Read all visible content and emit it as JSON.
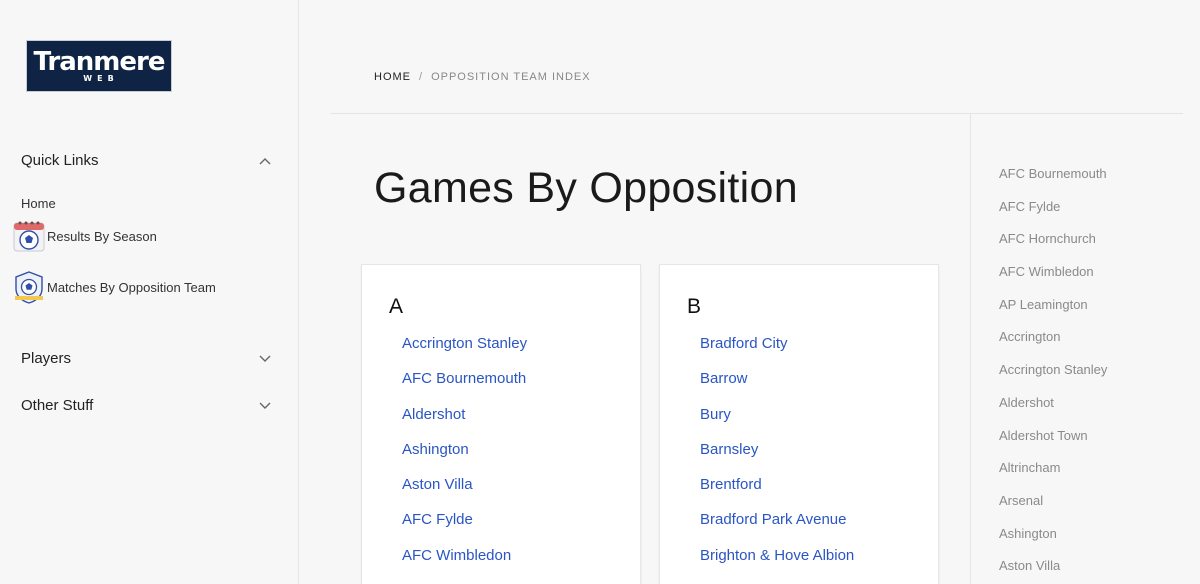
{
  "logo": {
    "main": "Tranmere",
    "sub": "WEB"
  },
  "sidebar": {
    "quick_links": {
      "label": "Quick Links",
      "items": [
        {
          "label": "Home"
        },
        {
          "label": "Results By Season",
          "icon": "calendar-football-icon"
        },
        {
          "label": "Matches By Opposition Team",
          "icon": "football-crest-icon"
        }
      ]
    },
    "players": {
      "label": "Players"
    },
    "other_stuff": {
      "label": "Other Stuff"
    }
  },
  "breadcrumb": {
    "home": "Home",
    "separator": "/",
    "current": "Opposition Team Index"
  },
  "page_title": "Games By Opposition",
  "sections": [
    {
      "letter": "A",
      "teams": [
        "Accrington Stanley",
        "AFC Bournemouth",
        "Aldershot",
        "Ashington",
        "Aston Villa",
        "AFC Fylde",
        "AFC Wimbledon"
      ]
    },
    {
      "letter": "B",
      "teams": [
        "Bradford City",
        "Barrow",
        "Bury",
        "Barnsley",
        "Brentford",
        "Bradford Park Avenue",
        "Brighton & Hove Albion"
      ]
    }
  ],
  "side_index": [
    "AFC Bournemouth",
    "AFC Fylde",
    "AFC Hornchurch",
    "AFC Wimbledon",
    "AP Leamington",
    "Accrington",
    "Accrington Stanley",
    "Aldershot",
    "Aldershot Town",
    "Altrincham",
    "Arsenal",
    "Ashington",
    "Aston Villa"
  ],
  "colors": {
    "link": "#2a55c4",
    "logo_bg": "#0f2444",
    "muted": "#8a8a8a"
  }
}
